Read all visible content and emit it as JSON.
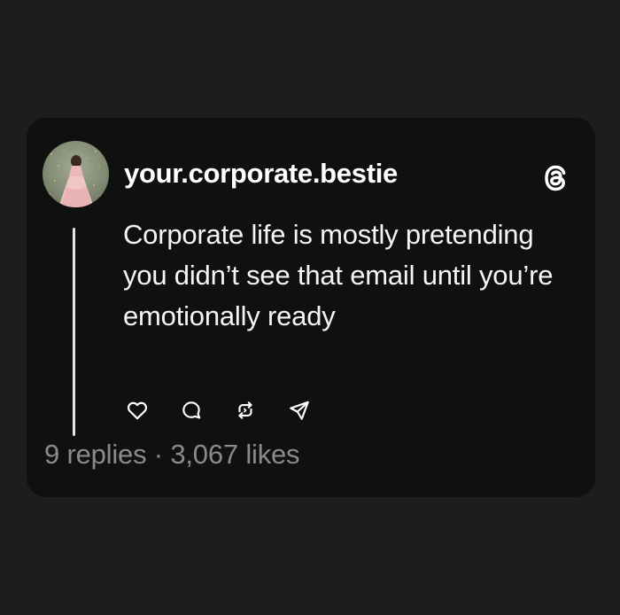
{
  "post": {
    "username": "your.corporate.bestie",
    "text": "Corporate life is mostly pretending you didn’t see that email until you’re emotionally ready",
    "replies": "9 replies",
    "separator": "·",
    "likes": "3,067 likes"
  },
  "icons": {
    "brand": "threads-logo-icon",
    "actions": [
      "heart-icon",
      "comment-icon",
      "repost-icon",
      "share-icon"
    ]
  },
  "colors": {
    "background": "#1d1d1d",
    "card": "#101010",
    "text": "#ffffff",
    "muted": "#8a8a8a"
  }
}
